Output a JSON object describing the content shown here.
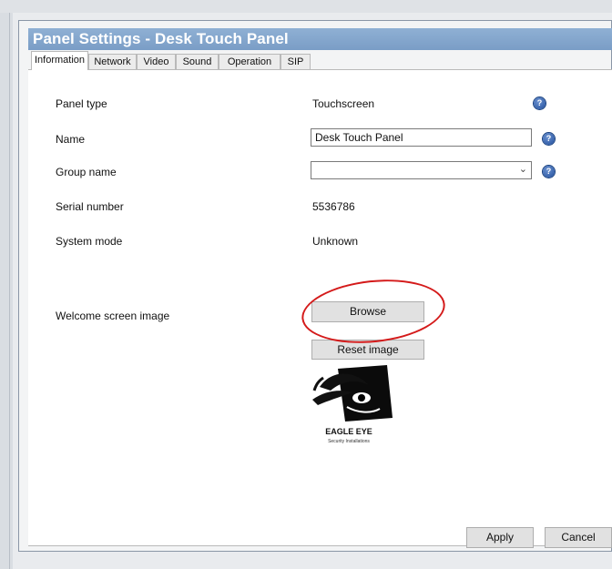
{
  "window": {
    "title": "Panel Settings - Desk Touch Panel"
  },
  "tabs": [
    {
      "label": "Information",
      "active": true
    },
    {
      "label": "Network"
    },
    {
      "label": "Video"
    },
    {
      "label": "Sound"
    },
    {
      "label": "Operation"
    },
    {
      "label": "SIP"
    }
  ],
  "fields": {
    "panel_type": {
      "label": "Panel type",
      "value": "Touchscreen"
    },
    "name": {
      "label": "Name",
      "value": "Desk Touch Panel"
    },
    "group_name": {
      "label": "Group name",
      "value": ""
    },
    "serial_number": {
      "label": "Serial number",
      "value": "5536786"
    },
    "system_mode": {
      "label": "System mode",
      "value": "Unknown"
    },
    "welcome_image": {
      "label": "Welcome screen image"
    }
  },
  "buttons": {
    "browse": "Browse",
    "reset_image": "Reset image",
    "apply": "Apply",
    "cancel": "Cancel"
  },
  "logo": {
    "name": "EAGLE EYE",
    "tagline": "Security Installations"
  },
  "colors": {
    "titlebar": "#7a9dc6",
    "highlight": "#d41a1a",
    "help_icon": "#1f4d9b"
  },
  "icons": {
    "help": "question-circle-icon",
    "dropdown": "chevron-down-icon"
  }
}
